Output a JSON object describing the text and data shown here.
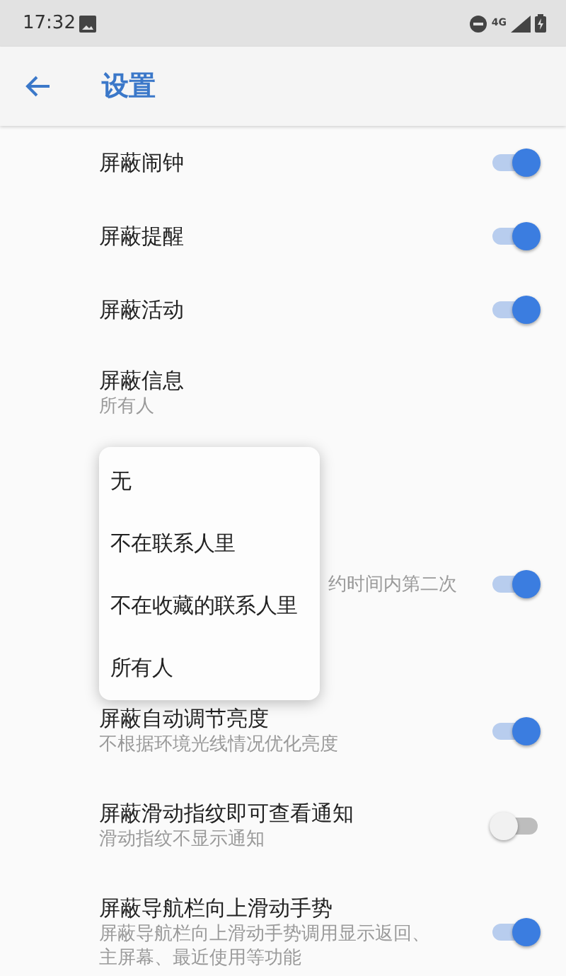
{
  "status_bar": {
    "time": "17:32",
    "network": "4G"
  },
  "app_bar": {
    "title": "设置"
  },
  "rows": [
    {
      "kind": "toggle",
      "title": "屏蔽闹钟",
      "on": true
    },
    {
      "kind": "toggle",
      "title": "屏蔽提醒",
      "on": true
    },
    {
      "kind": "toggle",
      "title": "屏蔽活动",
      "on": true
    },
    {
      "kind": "text",
      "title": "屏蔽信息",
      "subtitle": "所有人"
    },
    {
      "kind": "toggle",
      "subtitle": "约时间内第二次",
      "on": true
    },
    {
      "kind": "toggle",
      "title": "屏蔽自动调节亮度",
      "subtitle": "不根据环境光线情况优化亮度",
      "on": true
    },
    {
      "kind": "toggle",
      "title": "屏蔽滑动指纹即可查看通知",
      "subtitle": "滑动指纹不显示通知",
      "on": false
    },
    {
      "kind": "toggle",
      "title": "屏蔽导航栏向上滑动手势",
      "subtitle": "屏蔽导航栏向上滑动手势调用显示返回、主屏幕、最近使用等功能",
      "on": true
    }
  ],
  "menu": {
    "items": [
      "无",
      "不在联系人里",
      "不在收藏的联系人里",
      "所有人"
    ]
  }
}
